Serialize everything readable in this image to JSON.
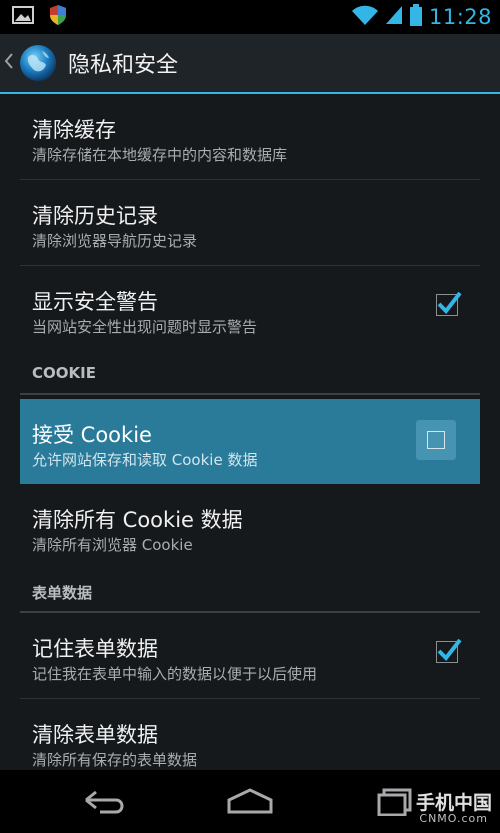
{
  "status_bar": {
    "time": "11:28",
    "icons": [
      "image-notification-icon",
      "shield-notification-icon",
      "wifi-icon",
      "signal-icon",
      "battery-icon"
    ]
  },
  "action_bar": {
    "title": "隐私和安全",
    "app_icon": "browser-globe-icon"
  },
  "items": {
    "clear_cache": {
      "title": "清除缓存",
      "summary": "清除存储在本地缓存中的内容和数据库"
    },
    "clear_history": {
      "title": "清除历史记录",
      "summary": "清除浏览器导航历史记录"
    },
    "security_warnings": {
      "title": "显示安全警告",
      "summary": "当网站安全性出现问题时显示警告",
      "checked": true
    }
  },
  "sections": {
    "cookie": "COOKIE",
    "form_data": "表单数据"
  },
  "cookie_items": {
    "accept_cookies": {
      "title": "接受 Cookie",
      "summary": "允许网站保存和读取 Cookie 数据",
      "checked": false
    },
    "clear_cookies": {
      "title": "清除所有 Cookie 数据",
      "summary": "清除所有浏览器 Cookie"
    }
  },
  "form_items": {
    "remember_form": {
      "title": "记住表单数据",
      "summary": "记住我在表单中输入的数据以便于以后使用",
      "checked": true
    },
    "clear_form": {
      "title": "清除表单数据",
      "summary": "清除所有保存的表单数据"
    }
  },
  "watermark": {
    "main": "手机中国",
    "sub": "CNMO.com"
  },
  "colors": {
    "accent": "#33b5e5",
    "highlight": "#2a7a99",
    "background": "#15191c"
  }
}
